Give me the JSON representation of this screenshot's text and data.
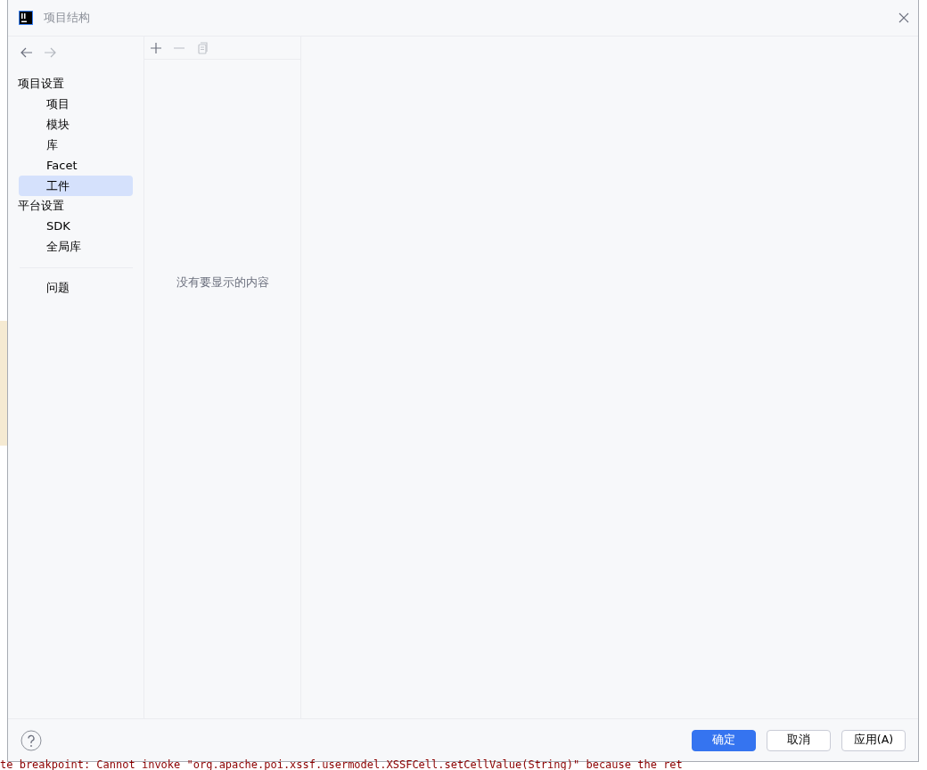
{
  "window": {
    "title": "项目结构"
  },
  "nav": [
    {
      "kind": "back",
      "disabled": false
    },
    {
      "kind": "forward",
      "disabled": true
    }
  ],
  "sidebar": {
    "sections": [
      {
        "title": "项目设置",
        "items": [
          {
            "label": "项目",
            "selected": false
          },
          {
            "label": "模块",
            "selected": false
          },
          {
            "label": "库",
            "selected": false
          },
          {
            "label": "Facet",
            "selected": false
          },
          {
            "label": "工件",
            "selected": true
          }
        ]
      },
      {
        "title": "平台设置",
        "items": [
          {
            "label": "SDK",
            "selected": false
          },
          {
            "label": "全局库",
            "selected": false
          }
        ]
      }
    ],
    "footer_items": [
      {
        "label": "问题",
        "selected": false
      }
    ]
  },
  "toolbar": [
    {
      "kind": "add",
      "disabled": false
    },
    {
      "kind": "remove",
      "disabled": true
    },
    {
      "kind": "copy",
      "disabled": true
    }
  ],
  "list": {
    "empty_text": "没有要显示的内容"
  },
  "buttons": [
    {
      "label": "确定",
      "kind": "primary"
    },
    {
      "label": "取消",
      "kind": "default"
    },
    {
      "label": "应用(A)",
      "kind": "default"
    }
  ],
  "background_log": "te breakpoint: Cannot invoke \"org.apache.poi.xssf.usermodel.XSSFCell.setCellValue(String)\" because the ret"
}
